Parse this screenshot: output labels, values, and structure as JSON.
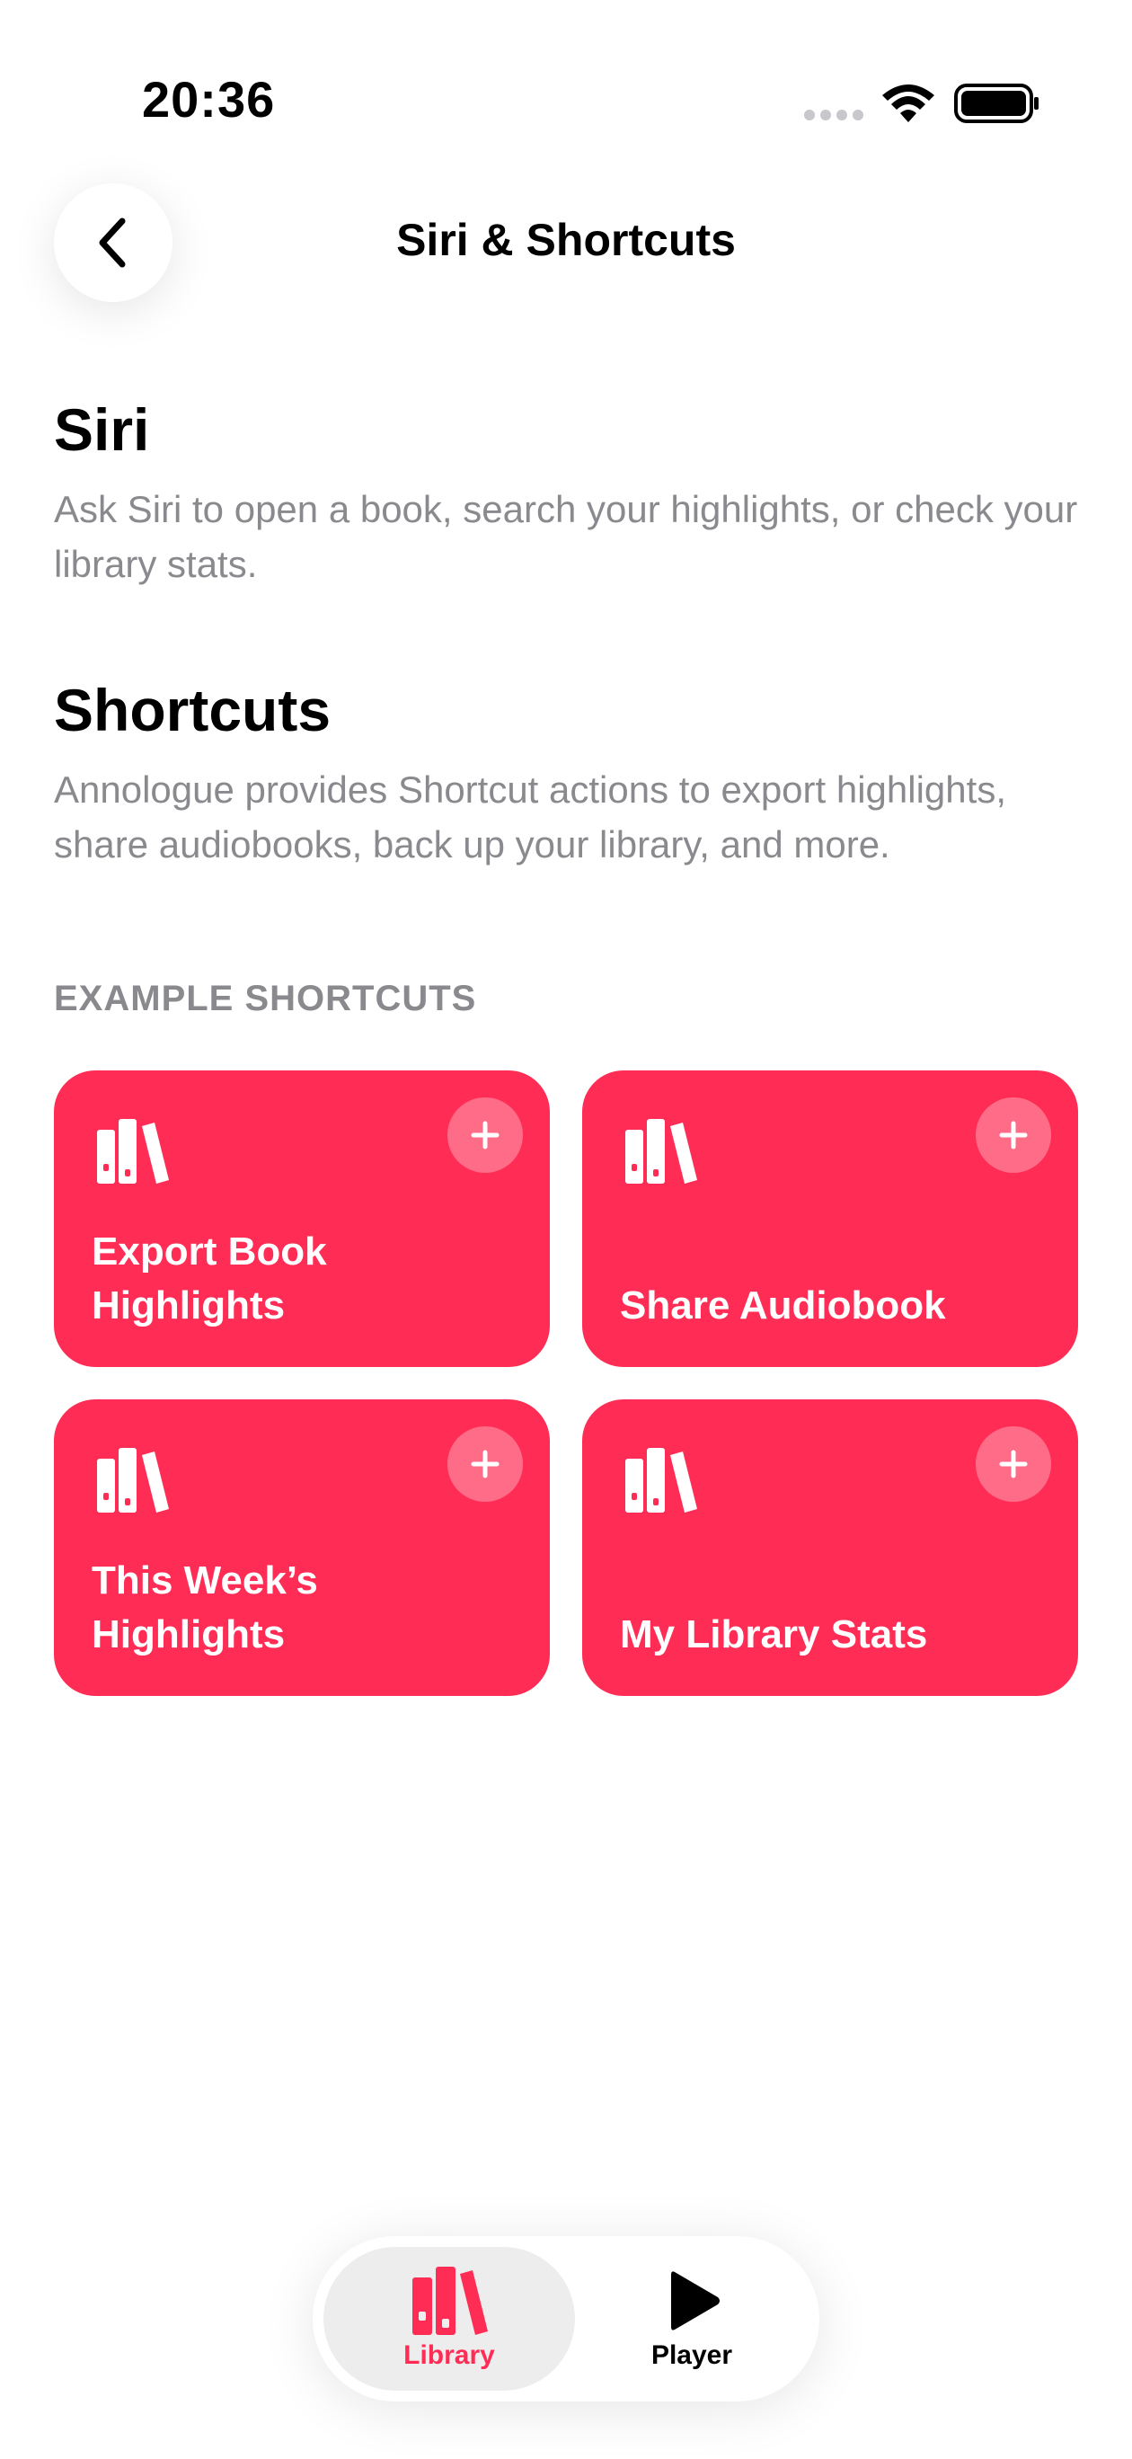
{
  "status_bar": {
    "time": "20:36"
  },
  "header": {
    "title": "Siri & Shortcuts",
    "back_icon": "chevron-left-icon"
  },
  "siri_section": {
    "title": "Siri",
    "description": "Ask Siri to open a book, search your highlights, or check your library stats."
  },
  "shortcuts_section": {
    "title": "Shortcuts",
    "description": "Annologue provides Shortcut actions to export highlights, share audiobooks, back up your library, and more.",
    "caption": "EXAMPLE SHORTCUTS",
    "cards": [
      {
        "label": "Export Book Highlights",
        "icon": "books-icon"
      },
      {
        "label": "Share Audiobook",
        "icon": "books-icon"
      },
      {
        "label": "This Week’s Highlights",
        "icon": "books-icon"
      },
      {
        "label": "My Library Stats",
        "icon": "books-icon"
      }
    ]
  },
  "tab_bar": {
    "tabs": [
      {
        "label": "Library",
        "icon": "books-icon",
        "active": true
      },
      {
        "label": "Player",
        "icon": "play-icon",
        "active": false
      }
    ]
  },
  "colors": {
    "accent": "#ff2d55",
    "secondary_text": "#8a8a8e"
  }
}
